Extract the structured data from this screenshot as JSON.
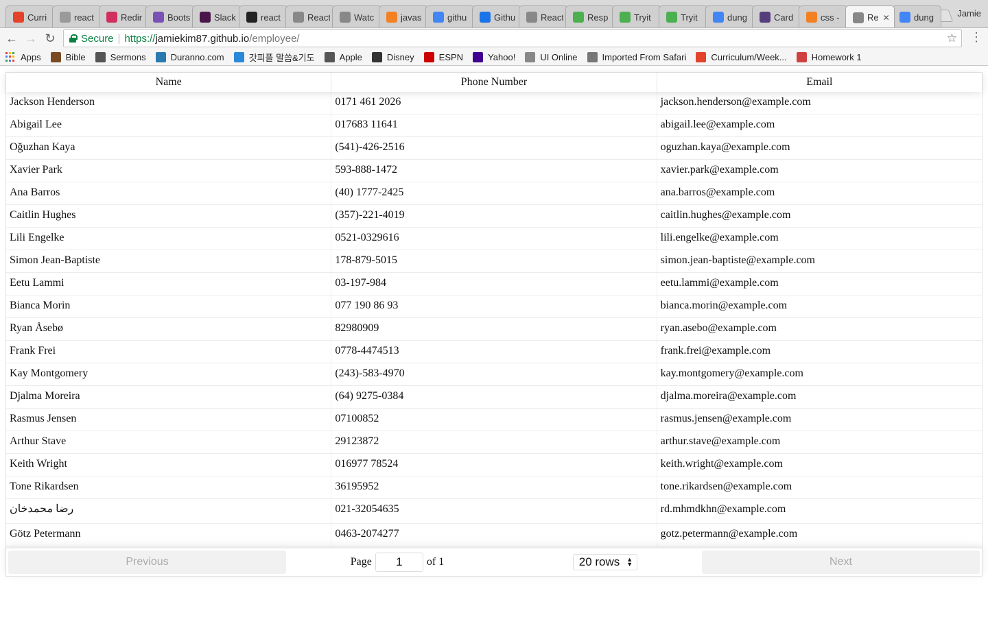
{
  "browser": {
    "tabs": [
      {
        "label": "Curri",
        "icon": "gitlab-icon",
        "color": "#e24329"
      },
      {
        "label": "react",
        "icon": "gear-icon",
        "color": "#9a9a9a"
      },
      {
        "label": "Redir",
        "icon": "slack-icon",
        "color": "#d1305e"
      },
      {
        "label": "Boots",
        "icon": "bootstrap-icon",
        "color": "#7952b3"
      },
      {
        "label": "Slack",
        "icon": "slack-icon",
        "color": "#4a154b"
      },
      {
        "label": "react",
        "icon": "github-icon",
        "color": "#222222"
      },
      {
        "label": "React",
        "icon": "page-icon",
        "color": "#888888"
      },
      {
        "label": "Watc",
        "icon": "page-icon",
        "color": "#888888"
      },
      {
        "label": "javas",
        "icon": "stackoverflow-icon",
        "color": "#f48024"
      },
      {
        "label": "githu",
        "icon": "google-icon",
        "color": "#4285f4"
      },
      {
        "label": "Githu",
        "icon": "flag-icon",
        "color": "#1a73e8"
      },
      {
        "label": "React",
        "icon": "page-icon",
        "color": "#888888"
      },
      {
        "label": "Resp",
        "icon": "w3schools-icon",
        "color": "#4caf50"
      },
      {
        "label": "Tryit",
        "icon": "w3schools-icon",
        "color": "#4caf50"
      },
      {
        "label": "Tryit",
        "icon": "w3schools-icon",
        "color": "#4caf50"
      },
      {
        "label": "dung",
        "icon": "google-icon",
        "color": "#4285f4"
      },
      {
        "label": "Card",
        "icon": "bootstrap-icon",
        "color": "#563d7c"
      },
      {
        "label": "css -",
        "icon": "stackoverflow-icon",
        "color": "#f48024"
      },
      {
        "label": "Re",
        "icon": "page-icon",
        "color": "#888888",
        "active": true
      },
      {
        "label": "dung",
        "icon": "google-icon",
        "color": "#4285f4"
      }
    ],
    "profile": "Jamie",
    "secure_label": "Secure",
    "url": {
      "scheme": "https://",
      "host": "jamiekim87.github.io",
      "path": "/employee/"
    },
    "bookmarks": [
      {
        "label": "Apps",
        "icon": "apps-grid-icon"
      },
      {
        "label": "Bible",
        "icon": "book-icon",
        "color": "#7a4b22"
      },
      {
        "label": "Sermons",
        "icon": "network-icon",
        "color": "#555555"
      },
      {
        "label": "Duranno.com",
        "icon": "duranno-icon",
        "color": "#2a7ab0"
      },
      {
        "label": "갓피플 말씀&기도",
        "icon": "p-icon",
        "color": "#2a88d8"
      },
      {
        "label": "Apple",
        "icon": "apple-icon",
        "color": "#555555"
      },
      {
        "label": "Disney",
        "icon": "disney-icon",
        "color": "#333333"
      },
      {
        "label": "ESPN",
        "icon": "espn-icon",
        "color": "#cc0000"
      },
      {
        "label": "Yahoo!",
        "icon": "yahoo-icon",
        "color": "#400090"
      },
      {
        "label": "UI Online",
        "icon": "page-icon",
        "color": "#888888"
      },
      {
        "label": "Imported From Safari",
        "icon": "folder-icon",
        "color": "#777777"
      },
      {
        "label": "Curriculum/Week...",
        "icon": "gitlab-icon",
        "color": "#e24329"
      },
      {
        "label": "Homework 1",
        "icon": "homework-icon",
        "color": "#d04040"
      }
    ]
  },
  "table": {
    "columns": [
      "Name",
      "Phone Number",
      "Email"
    ],
    "rows": [
      [
        "Jackson Henderson",
        "0171 461 2026",
        "jackson.henderson@example.com"
      ],
      [
        "Abigail Lee",
        "017683 11641",
        "abigail.lee@example.com"
      ],
      [
        "Oğuzhan Kaya",
        "(541)-426-2516",
        "oguzhan.kaya@example.com"
      ],
      [
        "Xavier Park",
        "593-888-1472",
        "xavier.park@example.com"
      ],
      [
        "Ana Barros",
        "(40) 1777-2425",
        "ana.barros@example.com"
      ],
      [
        "Caitlin Hughes",
        "(357)-221-4019",
        "caitlin.hughes@example.com"
      ],
      [
        "Lili Engelke",
        "0521-0329616",
        "lili.engelke@example.com"
      ],
      [
        "Simon Jean-Baptiste",
        "178-879-5015",
        "simon.jean-baptiste@example.com"
      ],
      [
        "Eetu Lammi",
        "03-197-984",
        "eetu.lammi@example.com"
      ],
      [
        "Bianca Morin",
        "077 190 86 93",
        "bianca.morin@example.com"
      ],
      [
        "Ryan Åsebø",
        "82980909",
        "ryan.asebo@example.com"
      ],
      [
        "Frank Frei",
        "0778-4474513",
        "frank.frei@example.com"
      ],
      [
        "Kay Montgomery",
        "(243)-583-4970",
        "kay.montgomery@example.com"
      ],
      [
        "Djalma Moreira",
        "(64) 9275-0384",
        "djalma.moreira@example.com"
      ],
      [
        "Rasmus Jensen",
        "07100852",
        "rasmus.jensen@example.com"
      ],
      [
        "Arthur Stave",
        "29123872",
        "arthur.stave@example.com"
      ],
      [
        "Keith Wright",
        "016977 78524",
        "keith.wright@example.com"
      ],
      [
        "Tone Rikardsen",
        "36195952",
        "tone.rikardsen@example.com"
      ],
      [
        "رضا محمدخان",
        "021-32054635",
        "rd.mhmdkhn@example.com"
      ],
      [
        "Götz Petermann",
        "0463-2074277",
        "gotz.petermann@example.com"
      ]
    ]
  },
  "pagination": {
    "previous_label": "Previous",
    "next_label": "Next",
    "page_label": "Page",
    "current_page": "1",
    "of_label": "of 1",
    "rows_option": "20 rows"
  }
}
